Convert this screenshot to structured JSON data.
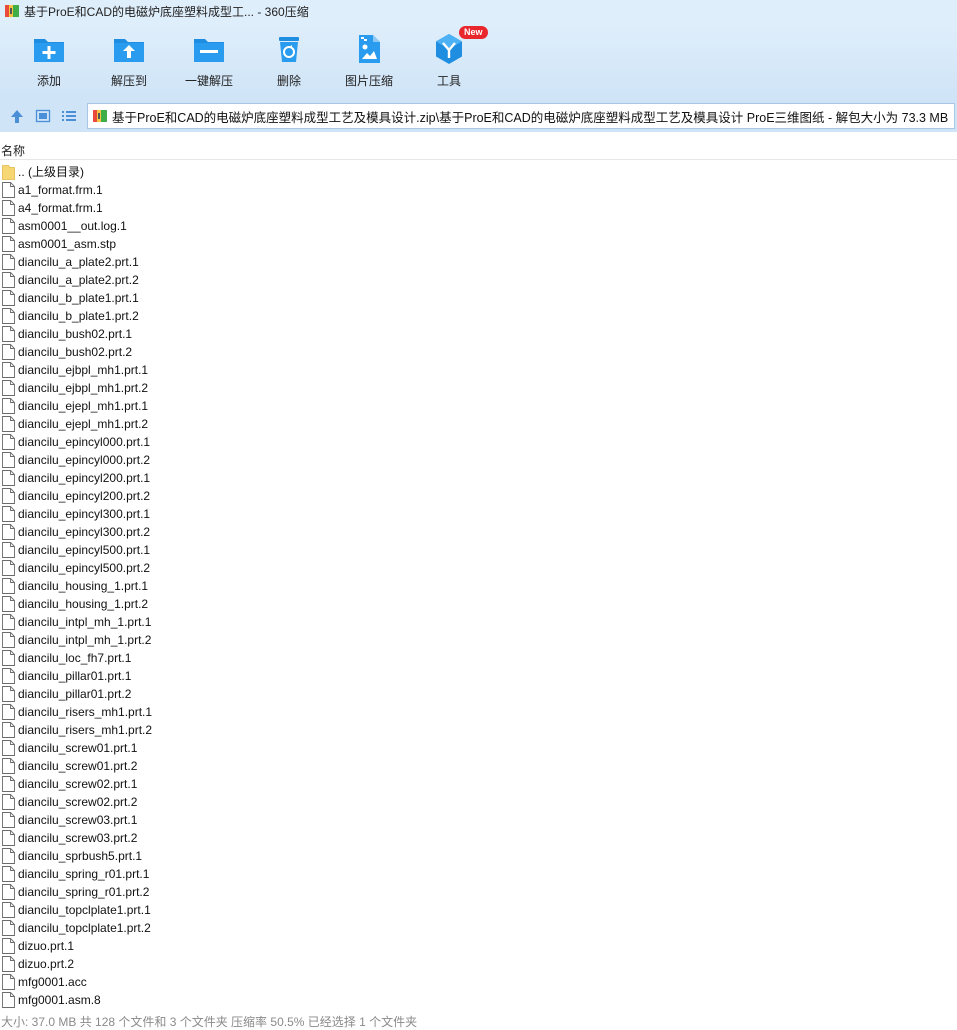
{
  "window": {
    "title": "基于ProE和CAD的电磁炉底座塑料成型工... - 360压缩"
  },
  "toolbar": {
    "items": [
      {
        "label": "添加",
        "icon": "add-icon"
      },
      {
        "label": "解压到",
        "icon": "extract-icon"
      },
      {
        "label": "一键解压",
        "icon": "one-click-extract-icon"
      },
      {
        "label": "删除",
        "icon": "delete-icon"
      },
      {
        "label": "图片压缩",
        "icon": "image-compress-icon"
      },
      {
        "label": "工具",
        "icon": "tools-icon",
        "badge": "New"
      }
    ]
  },
  "address": {
    "path": "基于ProE和CAD的电磁炉底座塑料成型工艺及模具设计.zip\\基于ProE和CAD的电磁炉底座塑料成型工艺及模具设计 ProE三维图纸 - 解包大小为 73.3 MB"
  },
  "list": {
    "column_name": "名称",
    "parent": ".. (上级目录)",
    "files": [
      "a1_format.frm.1",
      "a4_format.frm.1",
      "asm0001__out.log.1",
      "asm0001_asm.stp",
      "diancilu_a_plate2.prt.1",
      "diancilu_a_plate2.prt.2",
      "diancilu_b_plate1.prt.1",
      "diancilu_b_plate1.prt.2",
      "diancilu_bush02.prt.1",
      "diancilu_bush02.prt.2",
      "diancilu_ejbpl_mh1.prt.1",
      "diancilu_ejbpl_mh1.prt.2",
      "diancilu_ejepl_mh1.prt.1",
      "diancilu_ejepl_mh1.prt.2",
      "diancilu_epincyl000.prt.1",
      "diancilu_epincyl000.prt.2",
      "diancilu_epincyl200.prt.1",
      "diancilu_epincyl200.prt.2",
      "diancilu_epincyl300.prt.1",
      "diancilu_epincyl300.prt.2",
      "diancilu_epincyl500.prt.1",
      "diancilu_epincyl500.prt.2",
      "diancilu_housing_1.prt.1",
      "diancilu_housing_1.prt.2",
      "diancilu_intpl_mh_1.prt.1",
      "diancilu_intpl_mh_1.prt.2",
      "diancilu_loc_fh7.prt.1",
      "diancilu_pillar01.prt.1",
      "diancilu_pillar01.prt.2",
      "diancilu_risers_mh1.prt.1",
      "diancilu_risers_mh1.prt.2",
      "diancilu_screw01.prt.1",
      "diancilu_screw01.prt.2",
      "diancilu_screw02.prt.1",
      "diancilu_screw02.prt.2",
      "diancilu_screw03.prt.1",
      "diancilu_screw03.prt.2",
      "diancilu_sprbush5.prt.1",
      "diancilu_spring_r01.prt.1",
      "diancilu_spring_r01.prt.2",
      "diancilu_topclplate1.prt.1",
      "diancilu_topclplate1.prt.2",
      "dizuo.prt.1",
      "dizuo.prt.2",
      "mfg0001.acc",
      "mfg0001.asm.8"
    ]
  },
  "status": {
    "text": "大小: 37.0 MB 共 128 个文件和 3 个文件夹 压缩率 50.5% 已经选择 1 个文件夹"
  },
  "colors": {
    "accent": "#1f8ee0",
    "toolbar_bg": "#cfe4f7",
    "titlebar_bg": "#dfeefb"
  }
}
